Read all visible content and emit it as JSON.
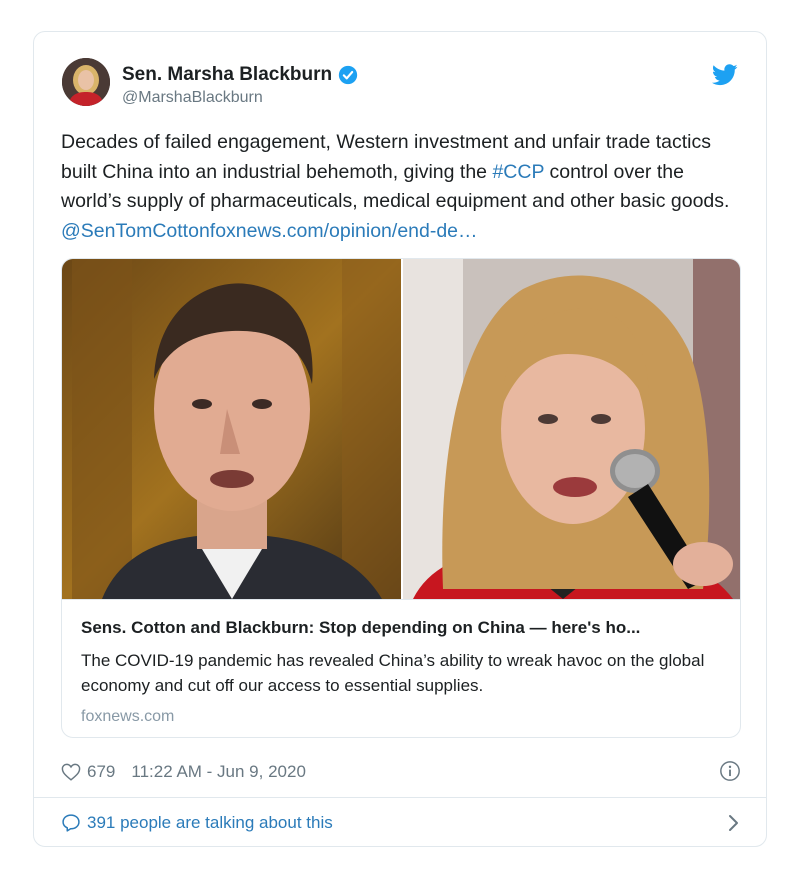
{
  "author": {
    "name": "Sen. Marsha Blackburn",
    "handle": "@MarshaBlackburn",
    "verified": true
  },
  "tweet": {
    "text_before_hashtag": "Decades of failed engagement, Western investment and unfair trade tactics built China into an industrial behemoth, giving the ",
    "hashtag": "#CCP",
    "text_after_hashtag": " control over the world’s supply of pharmaceuticals, medical equipment and other basic goods. ",
    "mention": "@SenTomCotton",
    "link": "foxnews.com/opinion/end-de…"
  },
  "card": {
    "title": "Sens. Cotton and Blackburn: Stop depending on China — here's ho...",
    "description": "The COVID-19 pandemic has revealed China’s ability to wreak havoc on the global economy and cut off our access to essential supplies.",
    "domain": "foxnews.com"
  },
  "footer": {
    "likes": "679",
    "timestamp": "11:22 AM - Jun 9, 2020"
  },
  "conversation": {
    "label": "391 people are talking about this"
  },
  "colors": {
    "link": "#2b7bb9",
    "verified": "#1da1f2",
    "muted": "#697882",
    "border": "#e1e8ed"
  },
  "icons": [
    "twitter-bird-icon",
    "verified-badge-icon",
    "heart-icon",
    "info-icon",
    "comment-bubble-icon",
    "chevron-right-icon"
  ]
}
